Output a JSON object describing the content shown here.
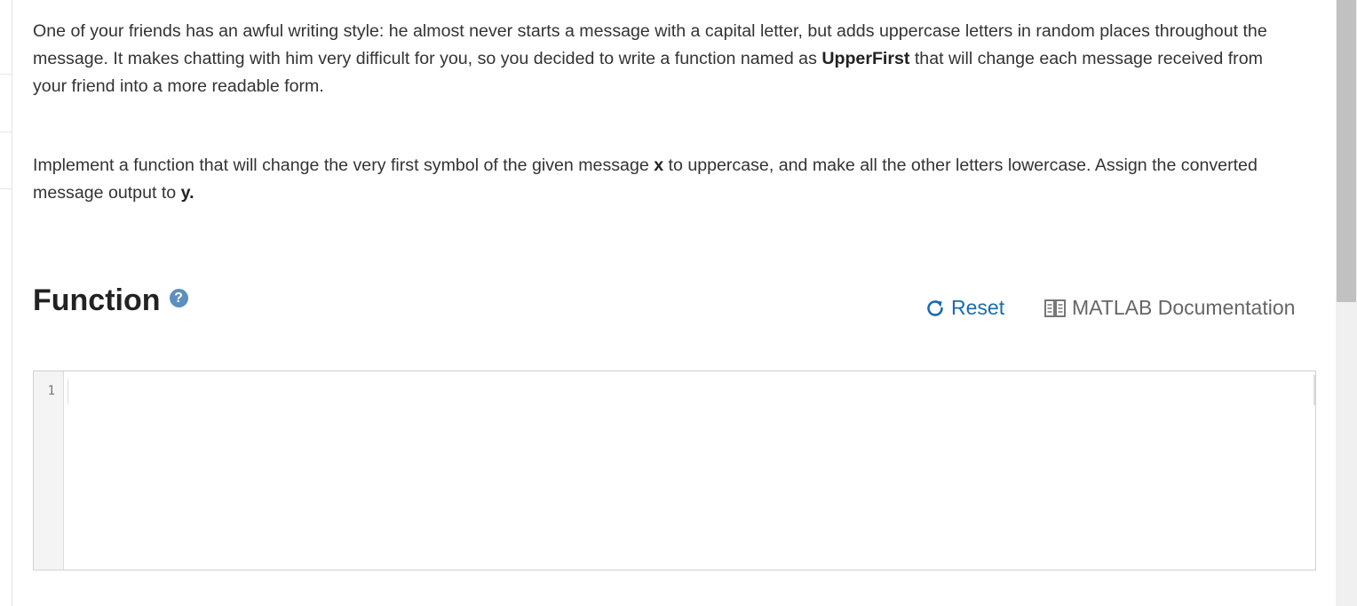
{
  "problem": {
    "paragraph1": {
      "before": "One of your friends has an awful writing style: he almost never starts a message with a capital letter, but adds uppercase letters in random places throughout the message. It makes chatting with him very difficult for you, so you decided to write a function named as ",
      "bold": "UpperFirst",
      "after": " that will change each message received from your friend into a more readable form."
    },
    "paragraph2": {
      "part1": "Implement a function that will change the very first symbol of the given message ",
      "bold1": "x",
      "part2": " to uppercase, and make all the other letters lowercase. Assign the converted message output to ",
      "bold2": "y."
    }
  },
  "function_section": {
    "heading": "Function",
    "help_icon_glyph": "?",
    "reset_label": "Reset",
    "doc_label": "MATLAB Documentation"
  },
  "editor": {
    "line_numbers": [
      "1"
    ],
    "code": ""
  },
  "colors": {
    "link_blue": "#1a6cb0",
    "help_icon_bg": "#5d8fc0",
    "text": "#333333"
  },
  "icons": {
    "help": "question-circle-icon",
    "reset": "refresh-icon",
    "doc": "book-icon"
  }
}
